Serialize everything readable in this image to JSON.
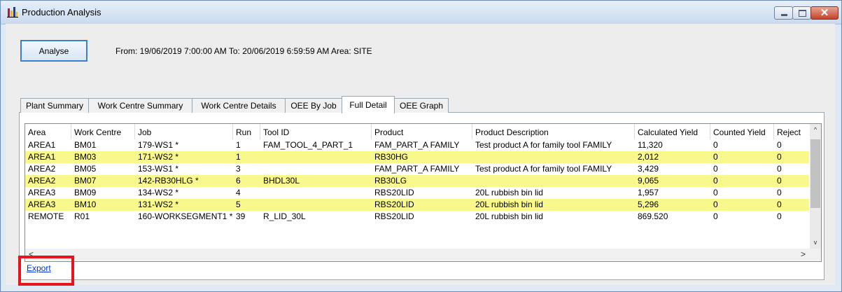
{
  "window": {
    "title": "Production Analysis",
    "close_glyph": "✕"
  },
  "toolbar": {
    "analyse_label": "Analyse",
    "range_text": "From: 19/06/2019 7:00:00 AM  To: 20/06/2019 6:59:59 AM  Area: SITE"
  },
  "tabs": [
    {
      "label": "Plant Summary",
      "active": false
    },
    {
      "label": "Work Centre Summary",
      "active": false
    },
    {
      "label": "Work Centre Details",
      "active": false
    },
    {
      "label": "OEE By Job",
      "active": false
    },
    {
      "label": "Full Detail",
      "active": true
    },
    {
      "label": "OEE Graph",
      "active": false
    }
  ],
  "table": {
    "columns": [
      "Area",
      "Work Centre",
      "Job",
      "Run",
      "Tool ID",
      "Product",
      "Product Description",
      "Calculated Yield",
      "Counted Yield",
      "Reject"
    ],
    "rows": [
      [
        "AREA1",
        "BM01",
        "179-WS1 *",
        "1",
        "FAM_TOOL_4_PART_1",
        "FAM_PART_A FAMILY",
        "Test product A for family tool FAMILY",
        "11,320",
        "0",
        "0"
      ],
      [
        "AREA1",
        "BM03",
        "171-WS2 *",
        "1",
        "",
        "RB30HG",
        "",
        "2,012",
        "0",
        "0"
      ],
      [
        "AREA2",
        "BM05",
        "153-WS1 *",
        "3",
        "",
        "FAM_PART_A FAMILY",
        "Test product A for family tool FAMILY",
        "3,429",
        "0",
        "0"
      ],
      [
        "AREA2",
        "BM07",
        "142-RB30HLG *",
        "6",
        "BHDL30L",
        "RB30LG",
        "",
        "9,065",
        "0",
        "0"
      ],
      [
        "AREA3",
        "BM09",
        "134-WS2 *",
        "4",
        "",
        "RBS20LID",
        "20L rubbish bin lid",
        "1,957",
        "0",
        "0"
      ],
      [
        "AREA3",
        "BM10",
        "131-WS2 *",
        "5",
        "",
        "RBS20LID",
        "20L rubbish bin lid",
        "5,296",
        "0",
        "0"
      ],
      [
        "REMOTE",
        "R01",
        "160-WORKSEGMENT1 *",
        "39",
        "R_LID_30L",
        "RBS20LID",
        "20L rubbish bin lid",
        "869.520",
        "0",
        "0"
      ]
    ],
    "alt_row_color": "#f8f88c",
    "scroll_up": "^",
    "scroll_down": "v",
    "scroll_left": "<",
    "scroll_right": ">"
  },
  "footer": {
    "export_label": "Export"
  },
  "colors": {
    "highlight": "#e5141e",
    "link": "#0033cc",
    "accent": "#3c7fc8"
  }
}
